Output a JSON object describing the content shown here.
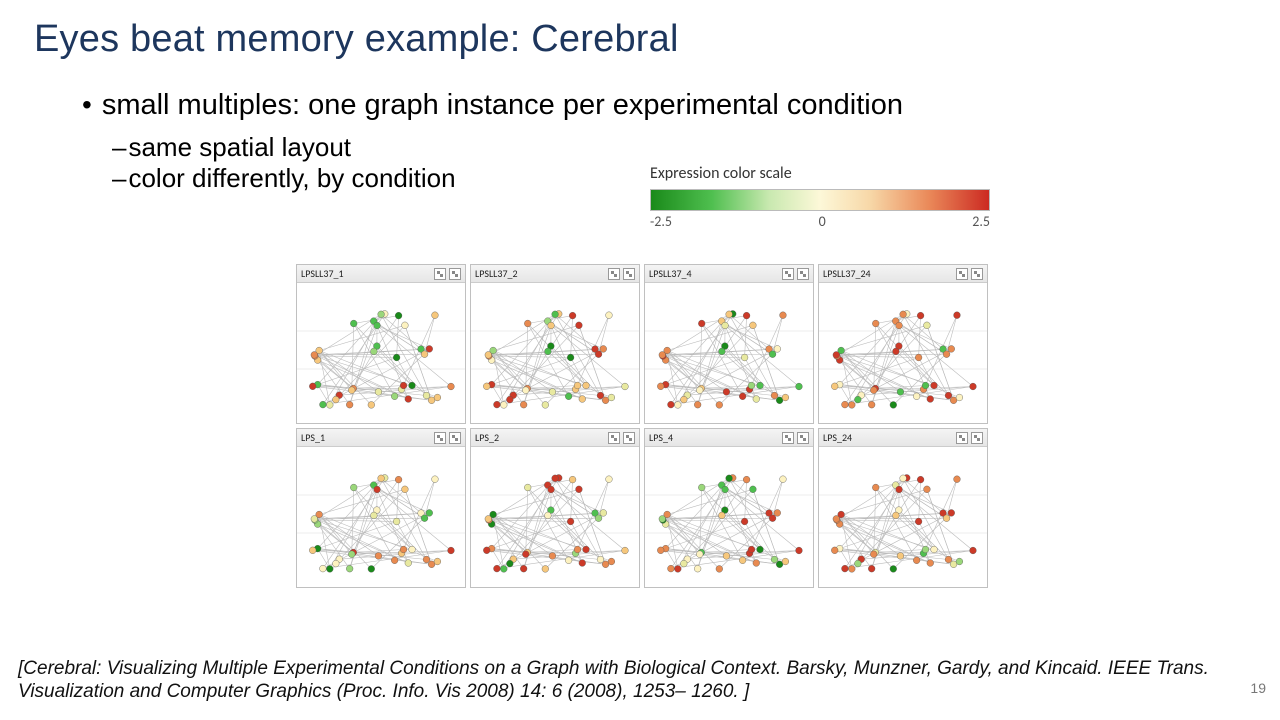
{
  "title": "Eyes beat memory example: Cerebral",
  "bullet": "small multiples: one graph instance per experimental condition",
  "sub1": "same spatial layout",
  "sub2": "color differently, by condition",
  "legend_name": "Expression color scale",
  "legend_min": "-2.5",
  "legend_mid": "0",
  "legend_max": "2.5",
  "panels": {
    "r0c0": "LPSLL37_1",
    "r0c1": "LPSLL37_2",
    "r0c2": "LPSLL37_4",
    "r0c3": "LPSLL37_24",
    "r1c0": "LPS_1",
    "r1c1": "LPS_2",
    "r1c2": "LPS_4",
    "r1c3": "LPS_24"
  },
  "citation": "[Cerebral: Visualizing Multiple Experimental Conditions on a Graph with Biological Context. Barsky, Munzner, Gardy, and Kincaid. IEEE Trans. Visualization and Computer Graphics (Proc. Info. Vis 2008) 14: 6 (2008), 1253– 1260. ]",
  "page": "19",
  "chart_data": {
    "type": "heatmap",
    "title": "Expression color scale",
    "xlabel": "",
    "ylabel": "",
    "ylim": [
      -2.5,
      2.5
    ],
    "categories": [
      "-2.5",
      "0",
      "2.5"
    ],
    "values": [
      -2.5,
      0,
      2.5
    ],
    "series": [
      {
        "name": "LPSLL37_1",
        "values": []
      },
      {
        "name": "LPSLL37_2",
        "values": []
      },
      {
        "name": "LPSLL37_4",
        "values": []
      },
      {
        "name": "LPSLL37_24",
        "values": []
      },
      {
        "name": "LPS_1",
        "values": []
      },
      {
        "name": "LPS_2",
        "values": []
      },
      {
        "name": "LPS_4",
        "values": []
      },
      {
        "name": "LPS_24",
        "values": []
      }
    ],
    "note": "Small-multiple node-link diagrams share identical spatial layout; node fill encodes expression on the diverging green–yellow–red scale shown in the legend."
  }
}
